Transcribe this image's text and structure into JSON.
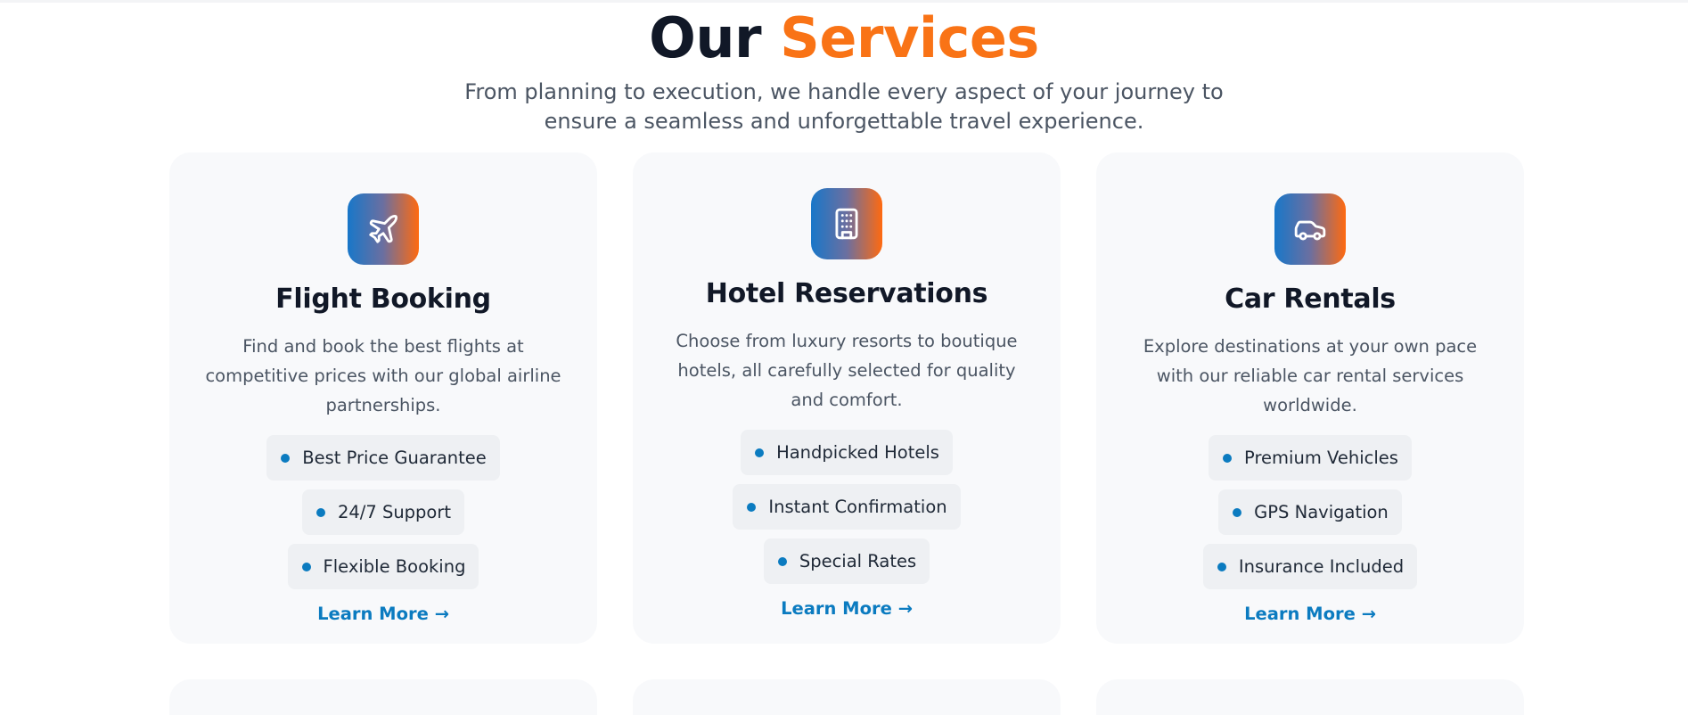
{
  "header": {
    "title_part1": "Our",
    "title_part2": "Services",
    "subtitle": "From planning to execution, we handle every aspect of your journey to ensure a seamless and unforgettable travel experience."
  },
  "colors": {
    "accent_orange": "#f97316",
    "accent_blue": "#0b7bc0",
    "card_background": "#f8f9fb"
  },
  "services": [
    {
      "icon": "airplane-icon",
      "title": "Flight Booking",
      "description": "Find and book the best flights at competitive prices with our global airline partnerships.",
      "features": [
        "Best Price Guarantee",
        "24/7 Support",
        "Flexible Booking"
      ],
      "link": "Learn More →"
    },
    {
      "icon": "building-icon",
      "title": "Hotel Reservations",
      "description": "Choose from luxury resorts to boutique hotels, all carefully selected for quality and comfort.",
      "features": [
        "Handpicked Hotels",
        "Instant Confirmation",
        "Special Rates"
      ],
      "link": "Learn More →"
    },
    {
      "icon": "car-icon",
      "title": "Car Rentals",
      "description": "Explore destinations at your own pace with our reliable car rental services worldwide.",
      "features": [
        "Premium Vehicles",
        "GPS Navigation",
        "Insurance Included"
      ],
      "link": "Learn More →"
    }
  ]
}
